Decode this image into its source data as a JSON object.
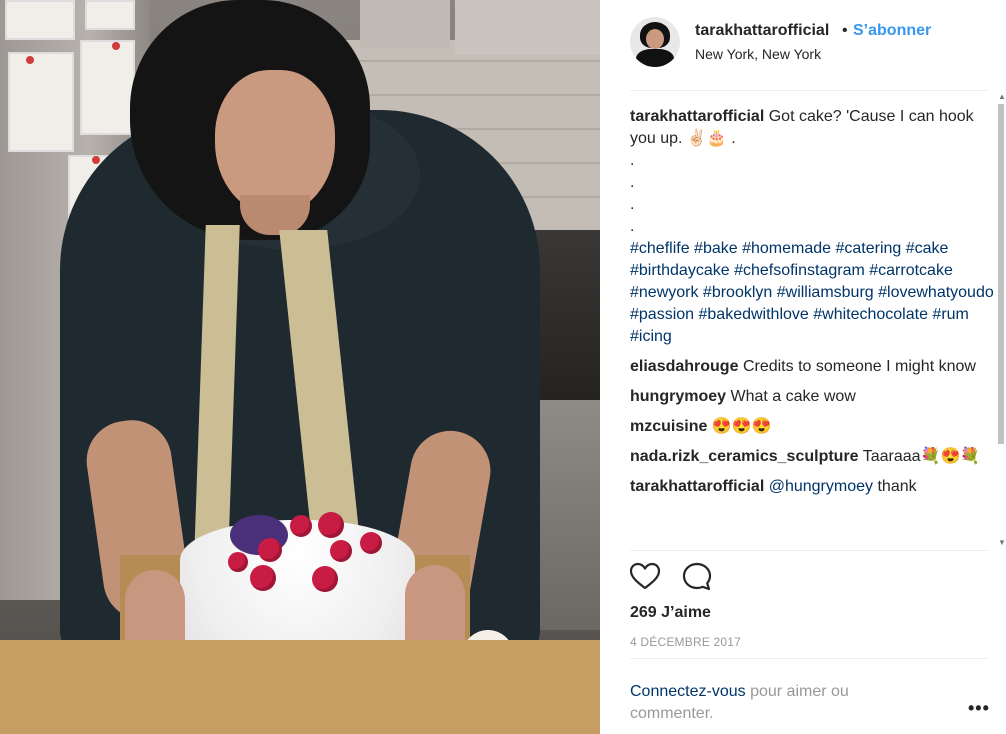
{
  "post": {
    "username": "tarakhattarofficial",
    "separator": "•",
    "follow_label": "S’abonner",
    "location": "New York, New York"
  },
  "caption": {
    "username": "tarakhattarofficial",
    "text": "Got cake? 'Cause I can hook you up. ✌🏻🎂 .",
    "dots": [
      ".",
      ".",
      ".",
      "."
    ],
    "hashtags": "#cheflife #bake #homemade #catering #cake #birthdaycake #chefsofinstagram #carrotcake #newyork #brooklyn #williamsburg #lovewhatyoudo #passion #bakedwithlove #whitechocolate #rum #icing"
  },
  "comments": [
    {
      "username": "eliasdahrouge",
      "text": "Credits to someone I might know"
    },
    {
      "username": "hungrymoey",
      "text": "What a cake wow"
    },
    {
      "username": "mzcuisine",
      "text": "😍😍😍"
    },
    {
      "username": "nada.rizk_ceramics_sculpture",
      "text": "Taaraaa💐😍💐"
    },
    {
      "username": "tarakhattarofficial",
      "mention": "@hungrymoey",
      "text": "thank"
    }
  ],
  "actions": {
    "like_icon": "heart-icon",
    "comment_icon": "comment-icon"
  },
  "likes": "269 J’aime",
  "date": "4 DÉCEMBRE 2017",
  "login_prompt": {
    "link": "Connectez-vous",
    "text": " pour aimer ou commenter."
  },
  "more_label": "•••",
  "colors": {
    "link_blue": "#3897f0",
    "hashtag_blue": "#003569",
    "muted_gray": "#999999"
  }
}
